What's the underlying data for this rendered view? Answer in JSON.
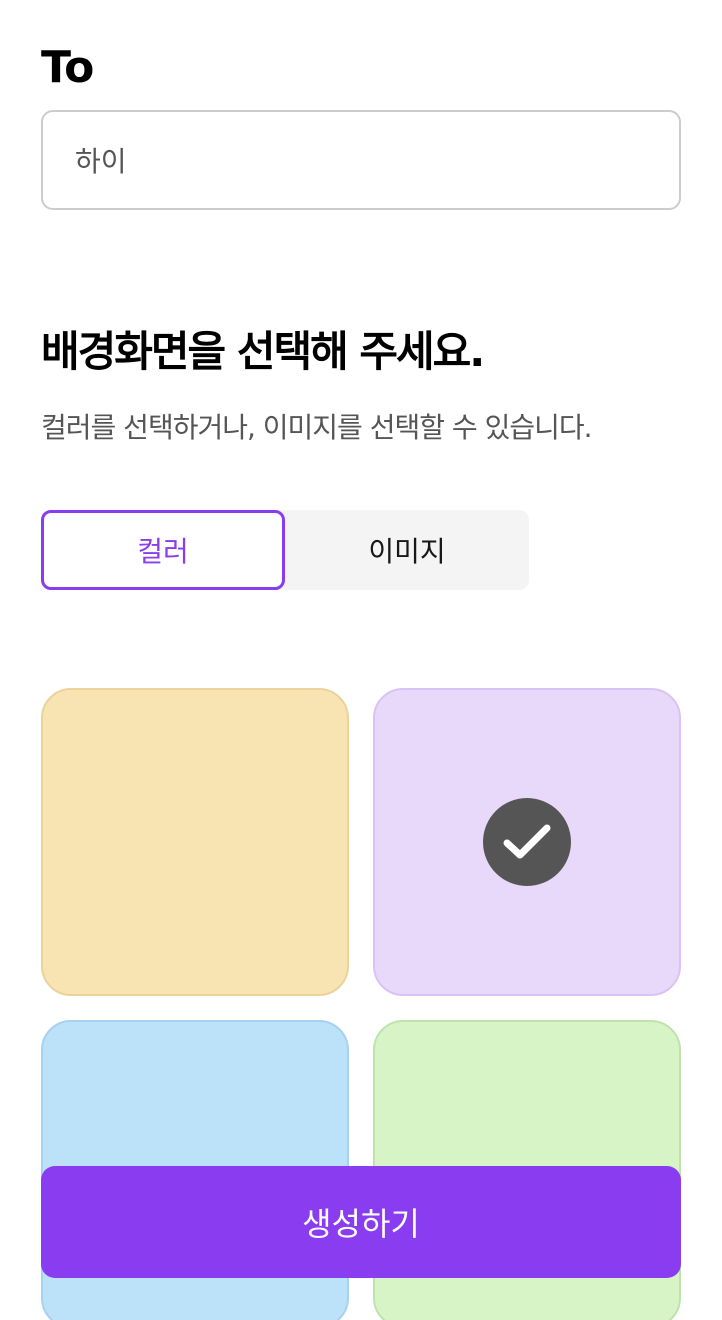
{
  "to_section": {
    "label": "To",
    "input_value": "하이"
  },
  "background_section": {
    "title": "배경화면을 선택해 주세요.",
    "description": "컬러를 선택하거나, 이미지를 선택할 수 있습니다."
  },
  "toggle": {
    "options": [
      {
        "label": "컬러",
        "active": true
      },
      {
        "label": "이미지",
        "active": false
      }
    ]
  },
  "swatches": [
    {
      "name": "beige",
      "fill": "#f8e3b3",
      "border": "#ecd29b",
      "selected": false
    },
    {
      "name": "purple",
      "fill": "#e8d8fa",
      "border": "#d9c3f4",
      "selected": true
    },
    {
      "name": "blue",
      "fill": "#bce2fa",
      "border": "#a7d1ef",
      "selected": false
    },
    {
      "name": "green",
      "fill": "#d6f4c6",
      "border": "#bfe3ad",
      "selected": false
    }
  ],
  "icons": {
    "selected_check": "check-icon"
  },
  "colors": {
    "accent": "#8a3cf0",
    "check_bg": "#555555"
  },
  "create_button": {
    "label": "생성하기"
  }
}
